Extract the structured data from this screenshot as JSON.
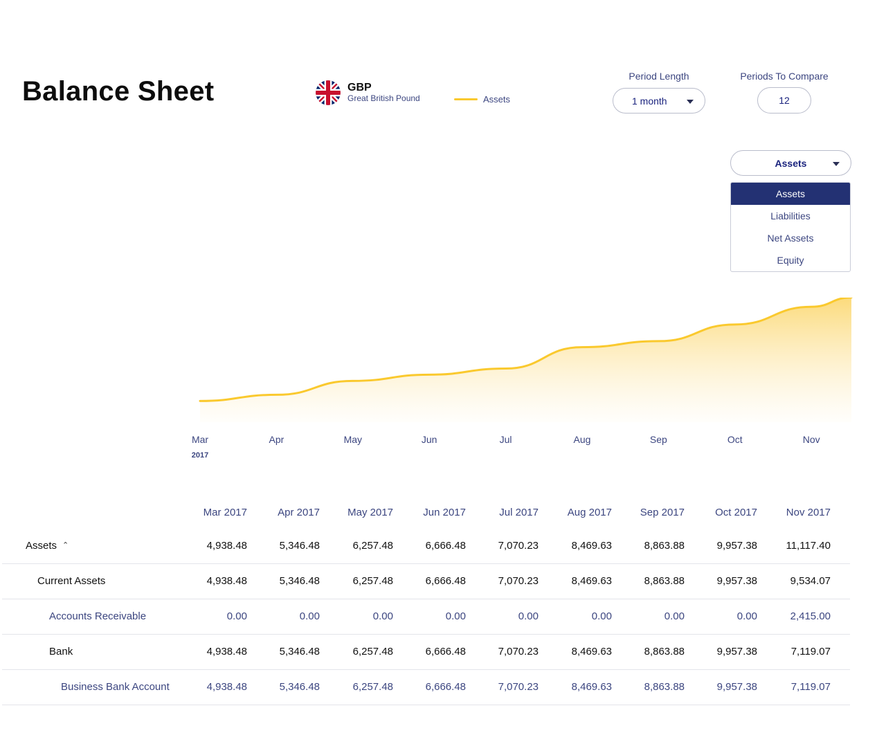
{
  "page": {
    "title": "Balance Sheet"
  },
  "currency": {
    "code": "GBP",
    "name": "Great British Pound"
  },
  "legend": {
    "label": "Assets",
    "color": "#fac92e"
  },
  "controls": {
    "period_length_label": "Period Length",
    "period_length_value": "1 month",
    "periods_to_compare_label": "Periods To Compare",
    "periods_to_compare_value": "12"
  },
  "type_select": {
    "value": "Assets",
    "options": [
      "Assets",
      "Liabilities",
      "Net Assets",
      "Equity"
    ],
    "selected_index": 0
  },
  "chart_data": {
    "type": "area",
    "categories": [
      "Mar",
      "Apr",
      "May",
      "Jun",
      "Jul",
      "Aug",
      "Sep",
      "Oct",
      "Nov"
    ],
    "first_year_label": "2017",
    "series": [
      {
        "values": [
          4938.48,
          5346.48,
          6257.48,
          6666.48,
          7070.23,
          8469.63,
          8863.88,
          9957.38,
          11117.4
        ]
      }
    ],
    "line_color": "#fac92e",
    "grid": false
  },
  "table": {
    "columns": [
      "Mar 2017",
      "Apr 2017",
      "May 2017",
      "Jun 2017",
      "Jul 2017",
      "Aug 2017",
      "Sep 2017",
      "Oct 2017",
      "Nov 2017"
    ],
    "rows": [
      {
        "label": "Assets",
        "level": 0,
        "style": "bold",
        "expandable": true,
        "values": [
          "4,938.48",
          "5,346.48",
          "6,257.48",
          "6,666.48",
          "7,070.23",
          "8,469.63",
          "8,863.88",
          "9,957.38",
          "11,117.40"
        ]
      },
      {
        "label": "Current Assets",
        "level": 1,
        "style": "bold",
        "values": [
          "4,938.48",
          "5,346.48",
          "6,257.48",
          "6,666.48",
          "7,070.23",
          "8,469.63",
          "8,863.88",
          "9,957.38",
          "9,534.07"
        ]
      },
      {
        "label": "Accounts Receivable",
        "level": 2,
        "style": "muted",
        "values": [
          "0.00",
          "0.00",
          "0.00",
          "0.00",
          "0.00",
          "0.00",
          "0.00",
          "0.00",
          "2,415.00"
        ]
      },
      {
        "label": "Bank",
        "level": 2,
        "style": "bold",
        "values": [
          "4,938.48",
          "5,346.48",
          "6,257.48",
          "6,666.48",
          "7,070.23",
          "8,469.63",
          "8,863.88",
          "9,957.38",
          "7,119.07"
        ]
      },
      {
        "label": "Business Bank Account",
        "level": 3,
        "style": "muted",
        "values": [
          "4,938.48",
          "5,346.48",
          "6,257.48",
          "6,666.48",
          "7,070.23",
          "8,469.63",
          "8,863.88",
          "9,957.38",
          "7,119.07"
        ]
      }
    ]
  }
}
